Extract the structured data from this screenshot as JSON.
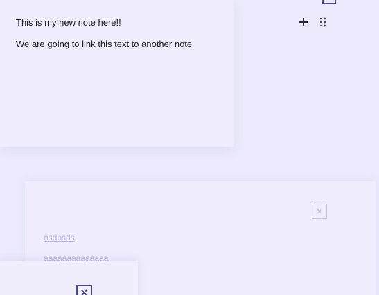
{
  "note_main": {
    "title": "This is my new note here!!",
    "body": "We are going to link this text to another note"
  },
  "note_second": {
    "line1": "nsdbsds",
    "line2": "aaaaaaaaaaaaaa"
  },
  "icons": {
    "add": "plus-icon",
    "drag": "drag-handle-icon",
    "close": "close-icon"
  },
  "colors": {
    "background": "#eceafc",
    "card": "#eeecfd",
    "icon_dark": "#2a2a3a",
    "frame_dark": "#4a4580",
    "faded_text": "#b9b2e6"
  }
}
